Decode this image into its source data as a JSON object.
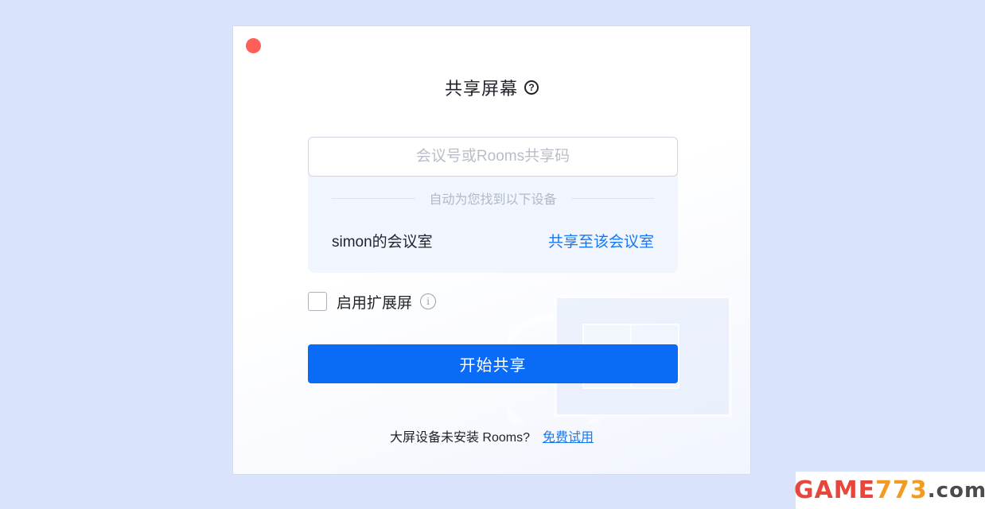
{
  "dialog": {
    "title": "共享屏幕",
    "help_icon_glyph": "?",
    "input_placeholder": "会议号或Rooms共享码",
    "auto_found_text": "自动为您找到以下设备",
    "device": {
      "name": "simon的会议室",
      "action": "共享至该会议室"
    },
    "extended_screen_label": "启用扩展屏",
    "info_icon_glyph": "i",
    "start_button": "开始共享",
    "footer_text": "大屏设备未安装 Rooms?",
    "footer_link": "免费试用"
  },
  "watermark": {
    "part1": "GAME",
    "part2": "773",
    "part3": ".com"
  },
  "colors": {
    "accent": "#0a6bf6",
    "link": "#1877f2",
    "close": "#fe5f57",
    "page_bg": "#d9e3fb"
  },
  "icons": [
    "close-icon",
    "help-icon",
    "info-icon"
  ]
}
